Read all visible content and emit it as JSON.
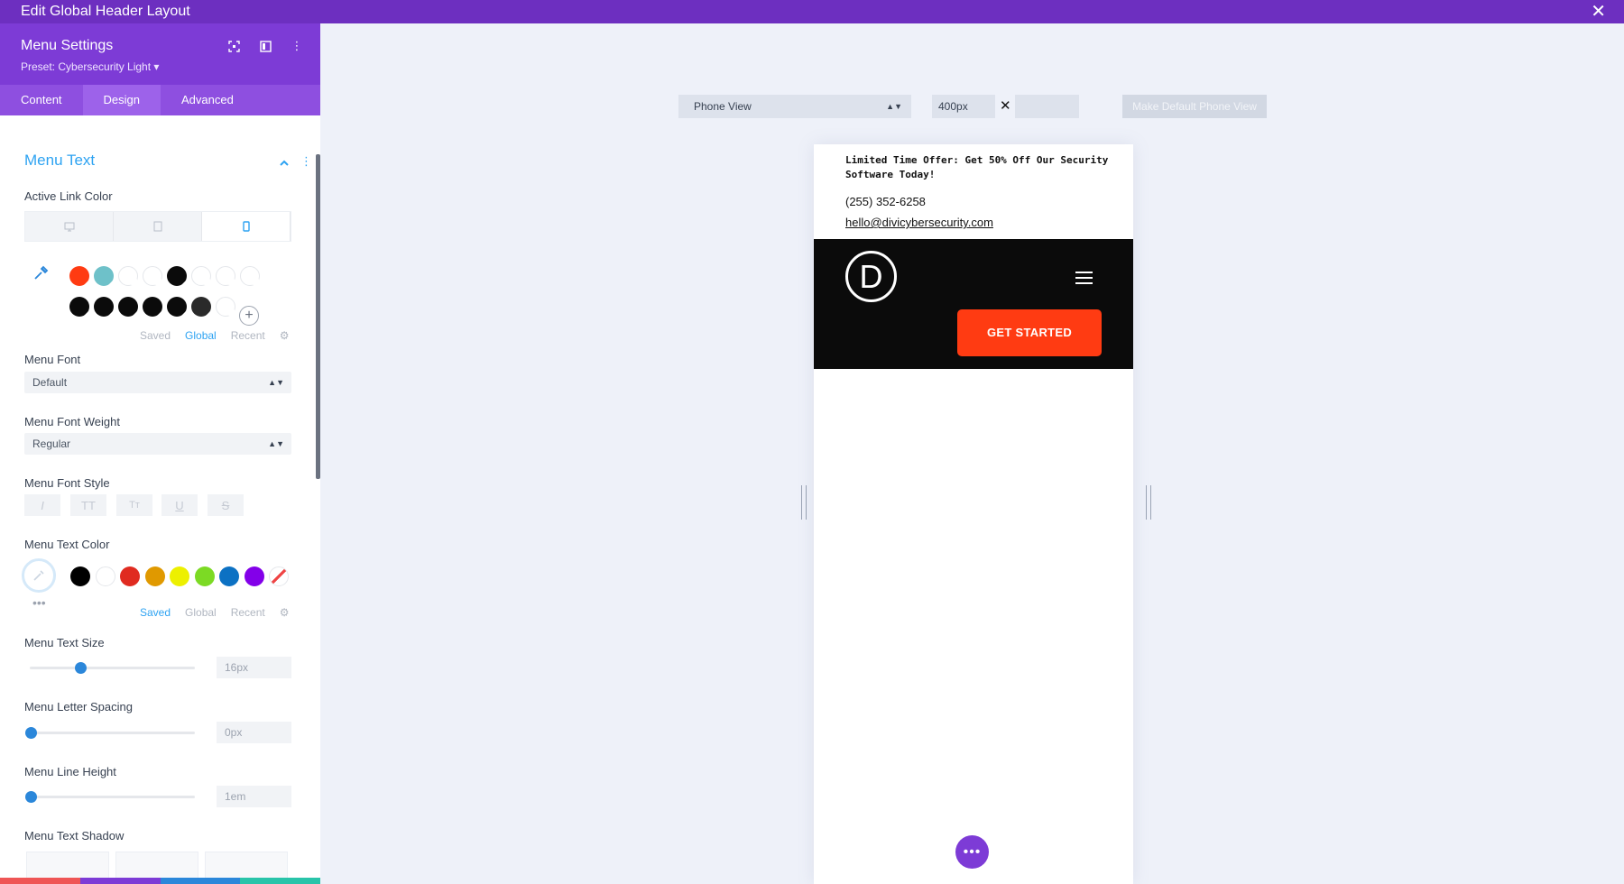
{
  "window": {
    "title": "Edit Global Header Layout",
    "close_icon": "close-icon"
  },
  "panel": {
    "title": "Menu Settings",
    "preset": "Preset: Cybersecurity Light ▾",
    "tabs": [
      {
        "label": "Content"
      },
      {
        "label": "Design"
      },
      {
        "label": "Advanced"
      }
    ],
    "active_tab": "Design",
    "section_title": "Menu Text",
    "active_link_color_label": "Active Link Color",
    "global_swatches_row1": [
      "#ff3b12",
      "#6ec1c9",
      "empty",
      "empty",
      "#0b0b0b",
      "empty",
      "empty",
      "empty"
    ],
    "global_swatches_row2": [
      "#0b0b0b",
      "#0b0b0b",
      "#0b0b0b",
      "#0b0b0b",
      "#0b0b0b",
      "#2a2a2a",
      "empty"
    ],
    "picker_tabs_1": {
      "saved": "Saved",
      "global": "Global",
      "recent": "Recent",
      "selected": "Global"
    },
    "menu_font_label": "Menu Font",
    "menu_font_value": "Default",
    "menu_font_weight_label": "Menu Font Weight",
    "menu_font_weight_value": "Regular",
    "menu_font_style_label": "Menu Font Style",
    "menu_text_color_label": "Menu Text Color",
    "text_color_swatches": [
      "#000000",
      "#ffffff",
      "#e02b20",
      "#e09900",
      "#edf000",
      "#7cda24",
      "#0c71c3",
      "#8300e9"
    ],
    "picker_tabs_2": {
      "saved": "Saved",
      "global": "Global",
      "recent": "Recent",
      "selected": "Saved"
    },
    "menu_text_size_label": "Menu Text Size",
    "menu_text_size_value": "16px",
    "menu_text_size_level": 0.3,
    "menu_letter_spacing_label": "Menu Letter Spacing",
    "menu_letter_spacing_value": "0px",
    "menu_letter_spacing_level": 0,
    "menu_line_height_label": "Menu Line Height",
    "menu_line_height_value": "1em",
    "menu_line_height_level": 0,
    "menu_text_shadow_label": "Menu Text Shadow",
    "bottom_bar_colors": [
      "#ef5555",
      "#7d3bd6",
      "#2b87da",
      "#29c4a9"
    ]
  },
  "preview": {
    "view_select": "Phone View",
    "width_value": "400px",
    "default_button": "Make Default Phone View",
    "offer_text": "Limited Time Offer: Get 50% Off Our Security Software Today!",
    "phone": "(255) 352-6258",
    "email": "hello@divicybersecurity.com",
    "logo_letter": "D",
    "cta": "GET STARTED"
  }
}
